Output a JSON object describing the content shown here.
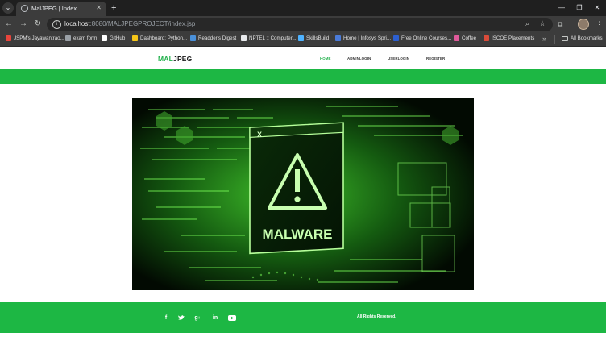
{
  "browser": {
    "tab": {
      "title": "MalJPEG | Index"
    },
    "address": {
      "host": "localhost",
      "rest": ":8080/MALJPEGPROJECT/index.jsp"
    },
    "bookmarks": [
      {
        "label": "JSPM's Jayawantrao...",
        "color": "#e8453c"
      },
      {
        "label": "exam form",
        "color": "#9aa0a6"
      },
      {
        "label": "GitHub",
        "color": "#ffffff"
      },
      {
        "label": "Dashboard: Python...",
        "color": "#f5c518"
      },
      {
        "label": "Readder's Digest",
        "color": "#4a90d9"
      },
      {
        "label": "NPTEL :: Computer...",
        "color": "#e8eaed"
      },
      {
        "label": "SkillsBuild",
        "color": "#4fb3ff"
      },
      {
        "label": "Home | Infosys Spri...",
        "color": "#4a7bd9"
      },
      {
        "label": "Free Online Courses...",
        "color": "#2c5fd0"
      },
      {
        "label": "Coffee",
        "color": "#e05a9b"
      },
      {
        "label": "ISCOE Placements",
        "color": "#d94b3a"
      }
    ],
    "all_bookmarks": "All Bookmarks"
  },
  "site": {
    "logo": {
      "part1": "MAL",
      "part2": "JPEG"
    },
    "nav": [
      {
        "label": "HOME",
        "active": true
      },
      {
        "label": "ADMINLOGIN",
        "active": false
      },
      {
        "label": "USERLOGIN",
        "active": false
      },
      {
        "label": "REGISTER",
        "active": false
      }
    ],
    "hero": {
      "warning_text": "MALWARE",
      "window_close": "X"
    },
    "footer": {
      "social": [
        "facebook-icon",
        "twitter-icon",
        "google-plus-icon",
        "linkedin-icon",
        "youtube-icon"
      ],
      "copyright": "All Rights Reserved."
    }
  },
  "colors": {
    "accent": "#1db744",
    "logo_accent": "#22b14c",
    "chrome_dark": "#1f1f1f",
    "chrome_mid": "#3c3c3c"
  }
}
